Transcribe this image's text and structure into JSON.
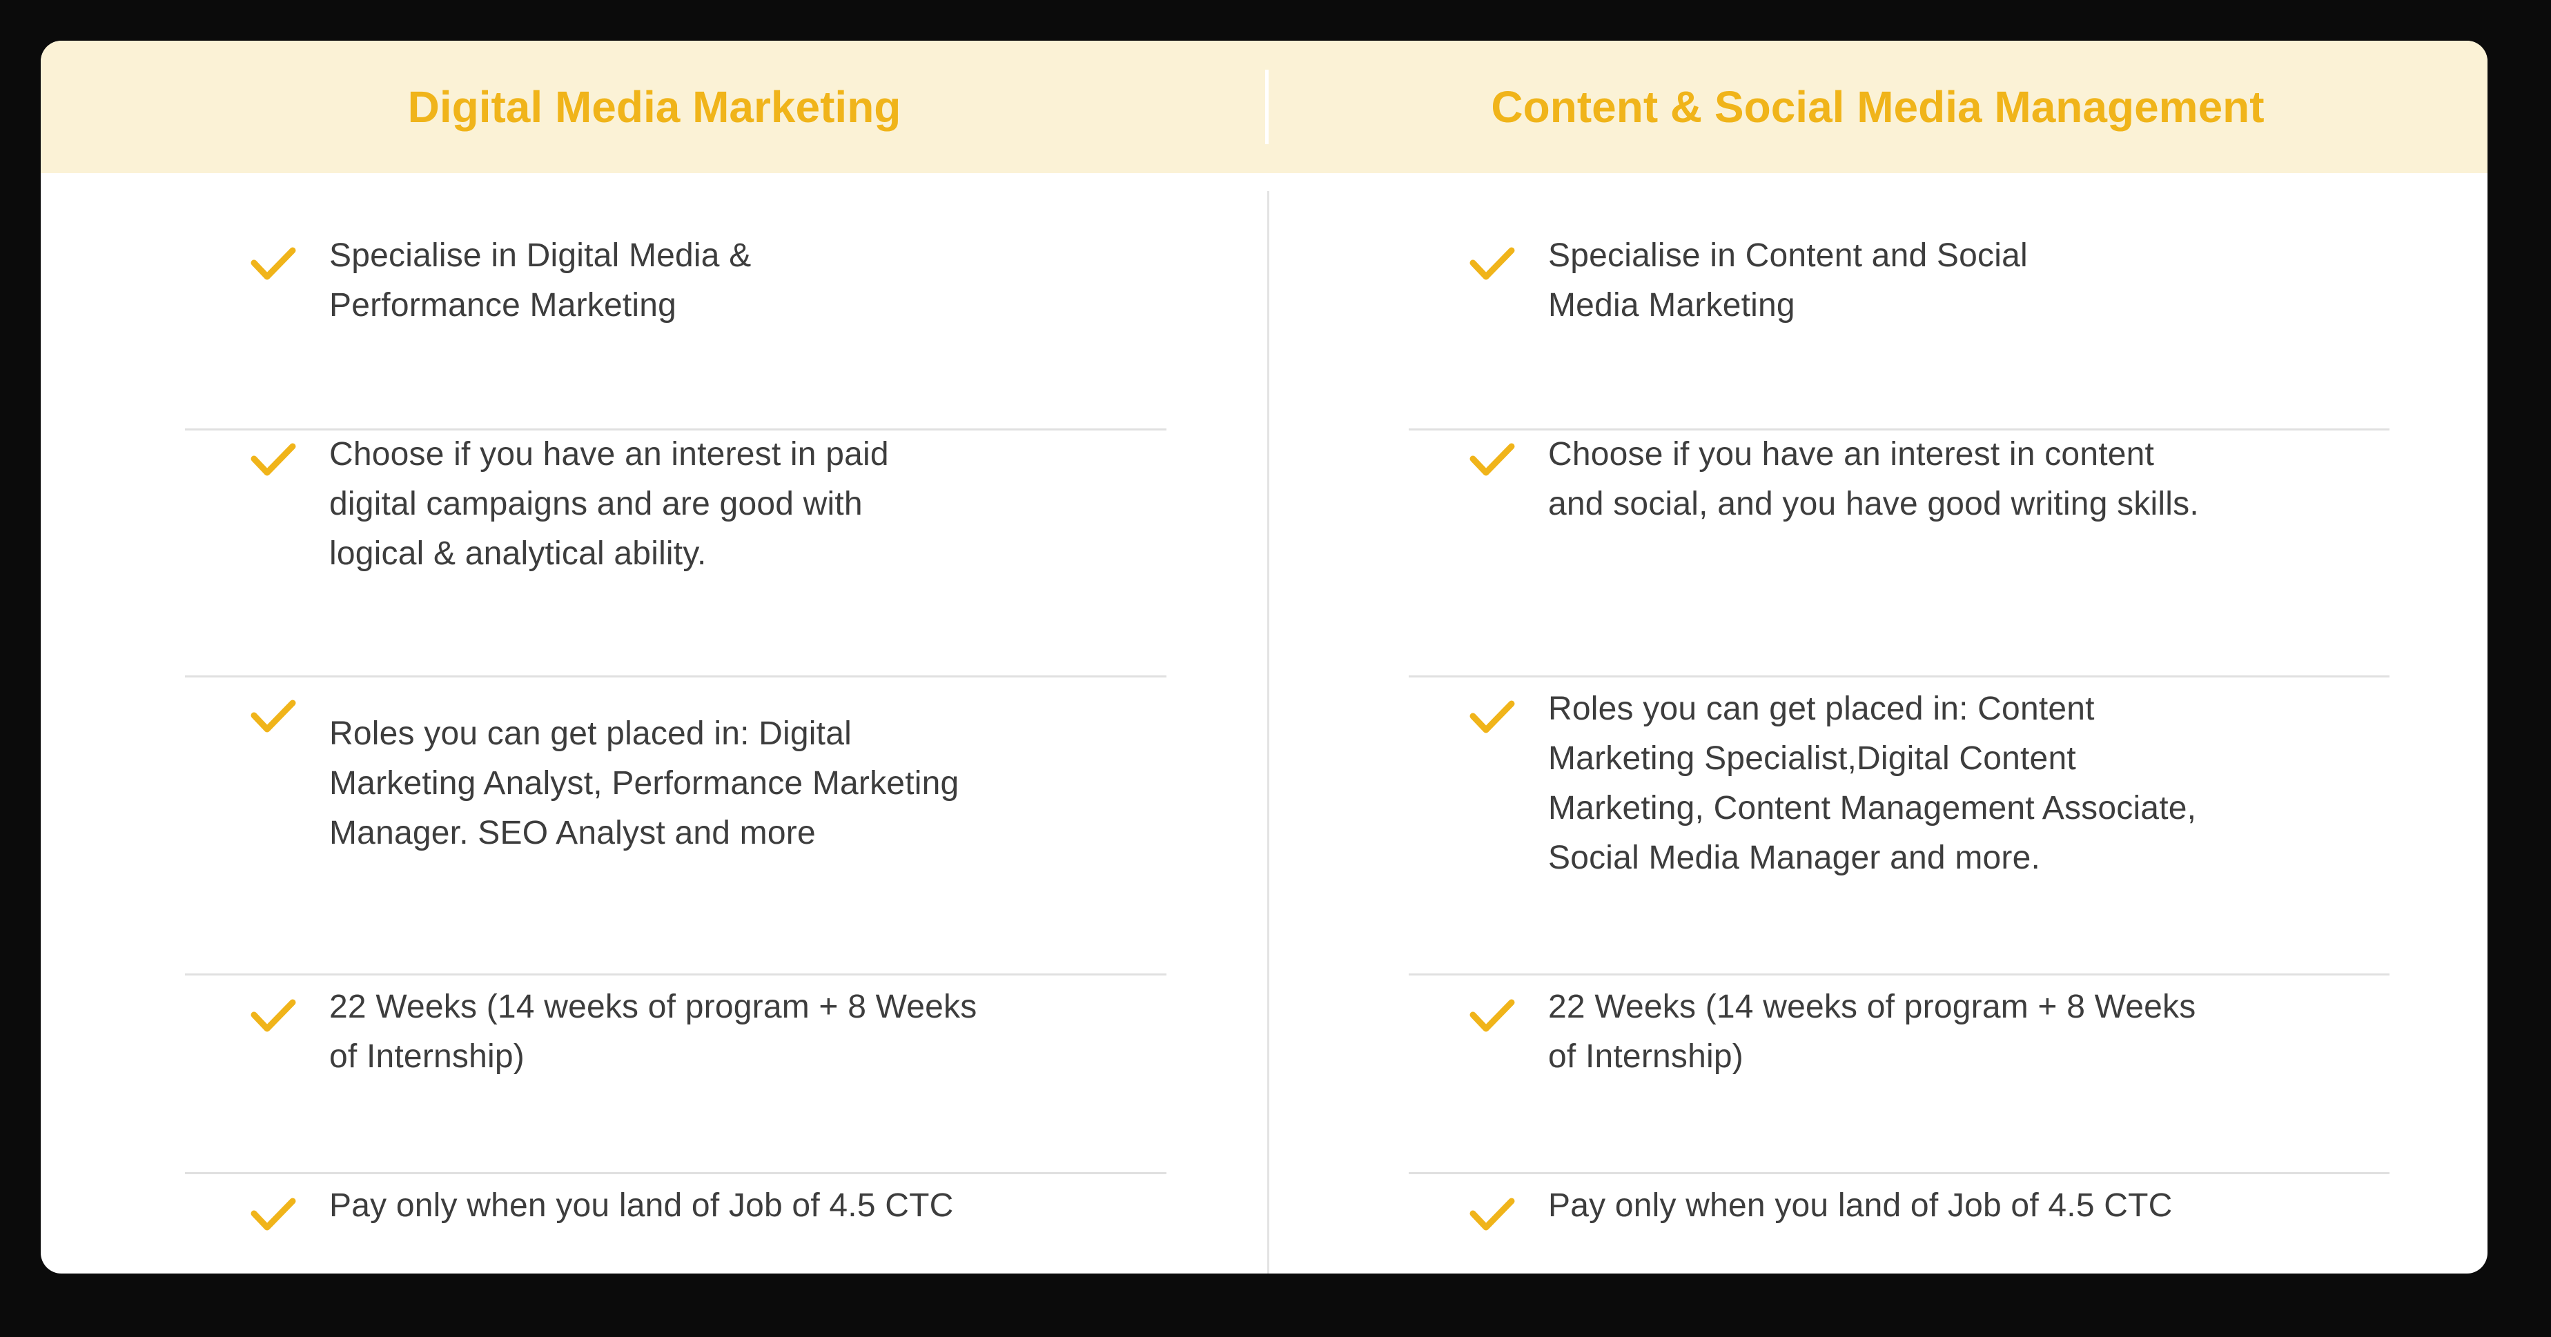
{
  "header": {
    "left_title": "Digital Media Marketing",
    "right_title": "Content & Social Media Management"
  },
  "columns": [
    {
      "items": [
        {
          "icon": "check-icon",
          "text": [
            "Specialise in Digital Media &",
            "Performance Marketing"
          ]
        },
        {
          "icon": "check-icon",
          "text": [
            "Choose if you have an interest in paid",
            "digital campaigns and are good with",
            "logical & analytical ability."
          ]
        },
        {
          "icon": "check-icon",
          "text": [
            "Roles you can get placed in: Digital",
            "Marketing Analyst, Performance Marketing",
            "Manager. SEO Analyst and more"
          ]
        },
        {
          "icon": "check-icon",
          "text": [
            "22 Weeks (14 weeks of program + 8 Weeks",
            "of Internship)"
          ]
        },
        {
          "icon": "check-icon",
          "text": [
            "Pay only when you land of Job of 4.5 CTC"
          ]
        }
      ]
    },
    {
      "items": [
        {
          "icon": "check-icon",
          "text": [
            "Specialise in Content and Social",
            "Media Marketing"
          ]
        },
        {
          "icon": "check-icon",
          "text": [
            "Choose if you have an interest in content",
            "and social, and you have good writing skills."
          ]
        },
        {
          "icon": "check-icon",
          "text": [
            "Roles you can get placed in: Content",
            "Marketing Specialist,Digital Content",
            "Marketing, Content Management Associate,",
            "Social Media Manager and more."
          ]
        },
        {
          "icon": "check-icon",
          "text": [
            "22 Weeks (14 weeks of program + 8 Weeks",
            "of Internship)"
          ]
        },
        {
          "icon": "check-icon",
          "text": [
            "Pay only when you land of Job of 4.5 CTC"
          ]
        }
      ]
    }
  ],
  "colors": {
    "accent": "#f0b41a",
    "header_bg": "#fbf2d6",
    "text": "#3d3d3d",
    "divider": "#e0e0e0"
  }
}
